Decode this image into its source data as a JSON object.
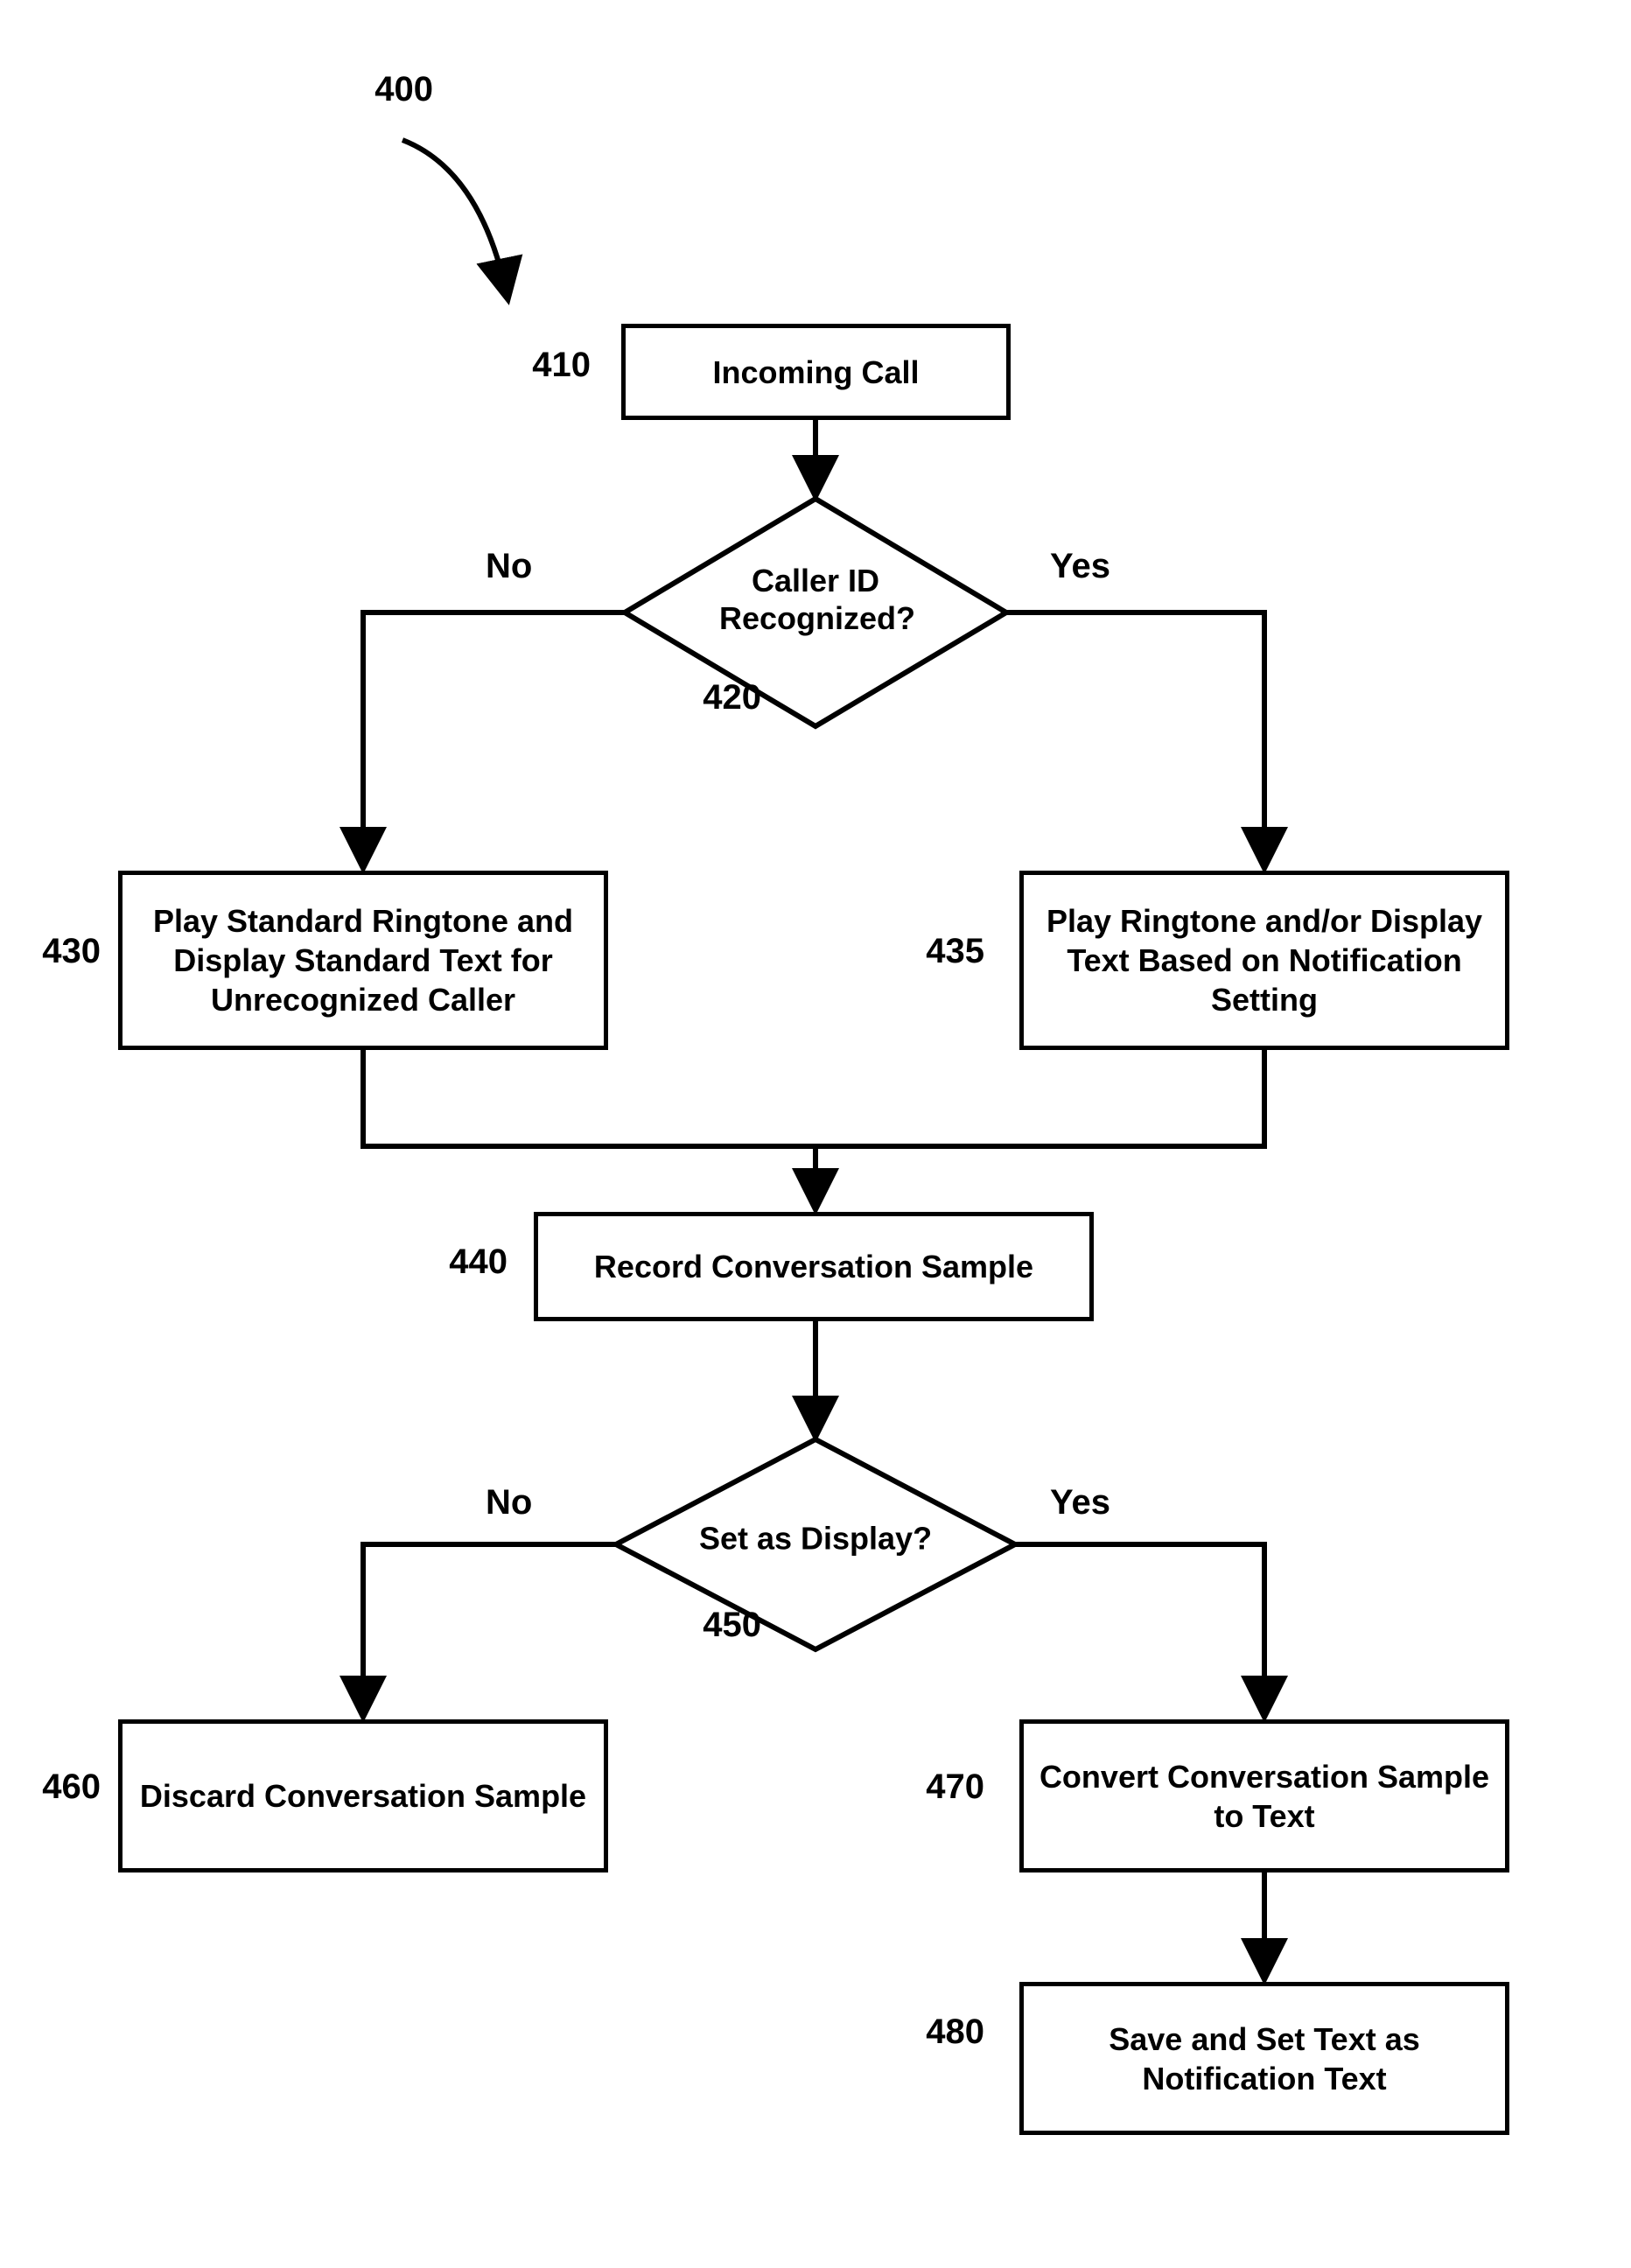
{
  "refs": {
    "ref400": "400",
    "ref410": "410",
    "ref420": "420",
    "ref430": "430",
    "ref435": "435",
    "ref440": "440",
    "ref450": "450",
    "ref460": "460",
    "ref470": "470",
    "ref480": "480"
  },
  "nodes": {
    "n410": "Incoming Call",
    "n420": "Caller ID Recognized?",
    "n430": "Play Standard Ringtone and Display Standard Text for Unrecognized Caller",
    "n435": "Play Ringtone and/or Display Text Based on Notification Setting",
    "n440": "Record Conversation Sample",
    "n450": "Set as Display?",
    "n460": "Discard Conversation Sample",
    "n470": "Convert Conversation Sample to Text",
    "n480": "Save and Set Text as Notification Text"
  },
  "edges": {
    "no": "No",
    "yes": "Yes"
  }
}
